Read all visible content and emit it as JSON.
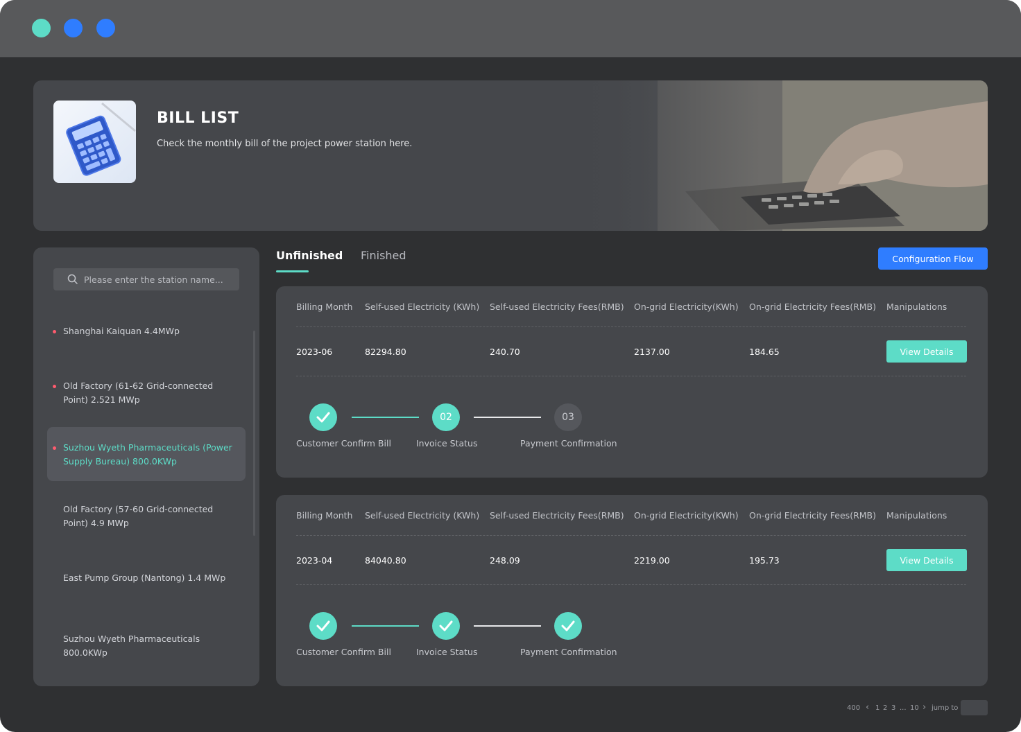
{
  "window": {
    "controls": [
      "close-dot",
      "minimize-dot",
      "maximize-dot"
    ],
    "control_colors": [
      "#5ddcc7",
      "#2f7dff",
      "#2f7dff"
    ]
  },
  "banner": {
    "title": "BILL LIST",
    "subtitle": "Check the monthly bill of the project power station here."
  },
  "sidebar": {
    "search_placeholder": "Please enter the station name...",
    "stations": [
      {
        "label": "Shanghai Kaiquan 4.4MWp",
        "dot": true,
        "active": false
      },
      {
        "label": "Old Factory (61-62 Grid-connected Point) 2.521 MWp",
        "dot": true,
        "active": false
      },
      {
        "label": "Suzhou Wyeth Pharmaceuticals (Power Supply Bureau) 800.0KWp",
        "dot": true,
        "active": true
      },
      {
        "label": "Old Factory (57-60 Grid-connected Point) 4.9 MWp",
        "dot": false,
        "active": false
      },
      {
        "label": "East Pump Group (Nantong) 1.4 MWp",
        "dot": false,
        "active": false
      },
      {
        "label": "Suzhou Wyeth Pharmaceuticals 800.0KWp",
        "dot": false,
        "active": false
      }
    ]
  },
  "tabs": [
    {
      "label": "Unfinished",
      "active": true
    },
    {
      "label": "Finished",
      "active": false
    }
  ],
  "config_button": "Configuration Flow",
  "columns": {
    "month": "Billing Month",
    "self_kwh": "Self-used Electricity (KWh)",
    "self_fee": "Self-used Electricity Fees(RMB)",
    "grid_kwh": "On-grid Electricity(KWh)",
    "grid_fee": "On-grid Electricity Fees(RMB)",
    "actions": "Manipulations"
  },
  "bills": [
    {
      "month": "2023-06",
      "self_kwh": "82294.80",
      "self_fee": "240.70",
      "grid_kwh": "2137.00",
      "grid_fee": "184.65",
      "action": "View Details",
      "steps": [
        {
          "label": "Customer Confirm Bill",
          "state": "done",
          "number": ""
        },
        {
          "label": "Invoice Status",
          "state": "current",
          "number": "02"
        },
        {
          "label": "Payment Confirmation",
          "state": "pending",
          "number": "03"
        }
      ]
    },
    {
      "month": "2023-04",
      "self_kwh": "84040.80",
      "self_fee": "248.09",
      "grid_kwh": "2219.00",
      "grid_fee": "195.73",
      "action": "View Details",
      "steps": [
        {
          "label": "Customer Confirm Bill",
          "state": "done",
          "number": ""
        },
        {
          "label": "Invoice Status",
          "state": "done",
          "number": ""
        },
        {
          "label": "Payment Confirmation",
          "state": "done",
          "number": ""
        }
      ]
    }
  ],
  "pagination": {
    "total": "400",
    "pages": [
      "1",
      "2",
      "3",
      "...",
      "10"
    ],
    "jump_label": "jump to"
  },
  "colors": {
    "accent_teal": "#5ddcc7",
    "accent_blue": "#2f7dff",
    "alert_dot": "#ff5b6e"
  }
}
